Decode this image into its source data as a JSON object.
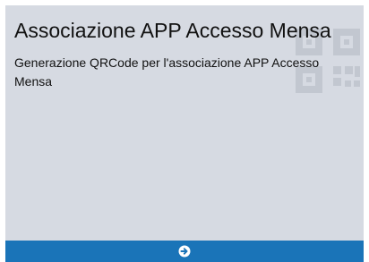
{
  "tile": {
    "title": "Associazione APP Accesso Mensa",
    "description": "Generazione QRCode per l'associazione APP Accesso Mensa",
    "background_icon": "qrcode-icon",
    "action_icon": "arrow-circle-right-icon",
    "colors": {
      "tile_background": "#d6dae2",
      "action_bar": "#1a74b8",
      "watermark": "#c2c7d0"
    }
  }
}
